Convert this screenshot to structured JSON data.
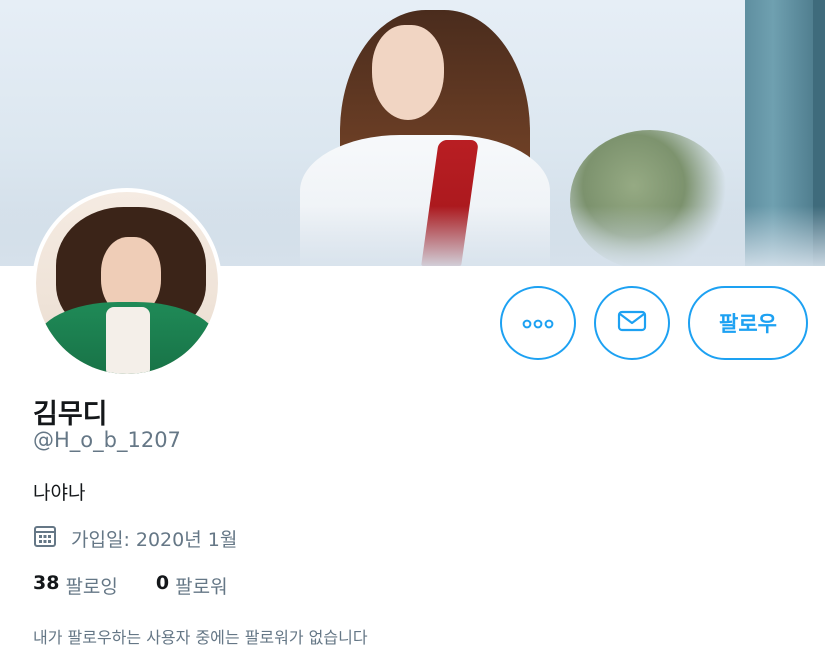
{
  "profile": {
    "name": "김무디",
    "handle": "@H_o_b_1207",
    "bio": "나야나",
    "joined": "가입일: 2020년 1월"
  },
  "actions": {
    "more_icon": "more-horizontal-icon",
    "message_icon": "envelope-icon",
    "follow_label": "팔로우"
  },
  "stats": {
    "following_count": "38",
    "following_label": "팔로잉",
    "followers_count": "0",
    "followers_label": "팔로워"
  },
  "notice": "내가 팔로우하는 사용자 중에는 팔로워가 없습니다",
  "colors": {
    "accent": "#1da1f2",
    "secondary_text": "#657786",
    "primary_text": "#14171a"
  }
}
